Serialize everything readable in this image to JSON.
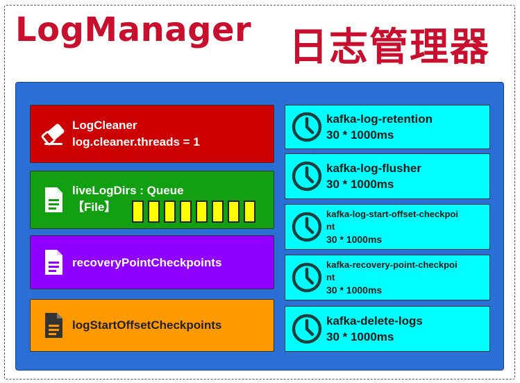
{
  "title": {
    "en": "LogManager",
    "cn": "日志管理器"
  },
  "left_boxes": [
    {
      "line1": "LogCleaner",
      "line2": "log.cleaner.threads = 1",
      "icon": "eraser-icon",
      "color": "#cc0000"
    },
    {
      "line1": "liveLogDirs : Queue",
      "line2": "【File】",
      "icon": "document-icon",
      "color": "#12a012",
      "queue_cells": 8
    },
    {
      "line1": "recoveryPointCheckpoints",
      "icon": "document-icon",
      "color": "#8f00ff"
    },
    {
      "line1": "logStartOffsetCheckpoints",
      "icon": "document-icon",
      "color": "#ff9900"
    }
  ],
  "scheduled_tasks": [
    {
      "name": "kafka-log-retention",
      "interval": "30 * 1000ms"
    },
    {
      "name": "kafka-log-flusher",
      "interval": "30 * 1000ms"
    },
    {
      "name_line1": "kafka-log-start-offset-checkpoi",
      "name_line2": "nt",
      "interval": "30 * 1000ms"
    },
    {
      "name_line1": "kafka-recovery-point-checkpoi",
      "name_line2": "nt",
      "interval": "30 * 1000ms"
    },
    {
      "name": "kafka-delete-logs",
      "interval": "30 * 1000ms"
    }
  ],
  "colors": {
    "title": "#c8102e",
    "board": "#2a6fd6",
    "task": "#00ffff",
    "queue_cell": "#ffff00"
  }
}
